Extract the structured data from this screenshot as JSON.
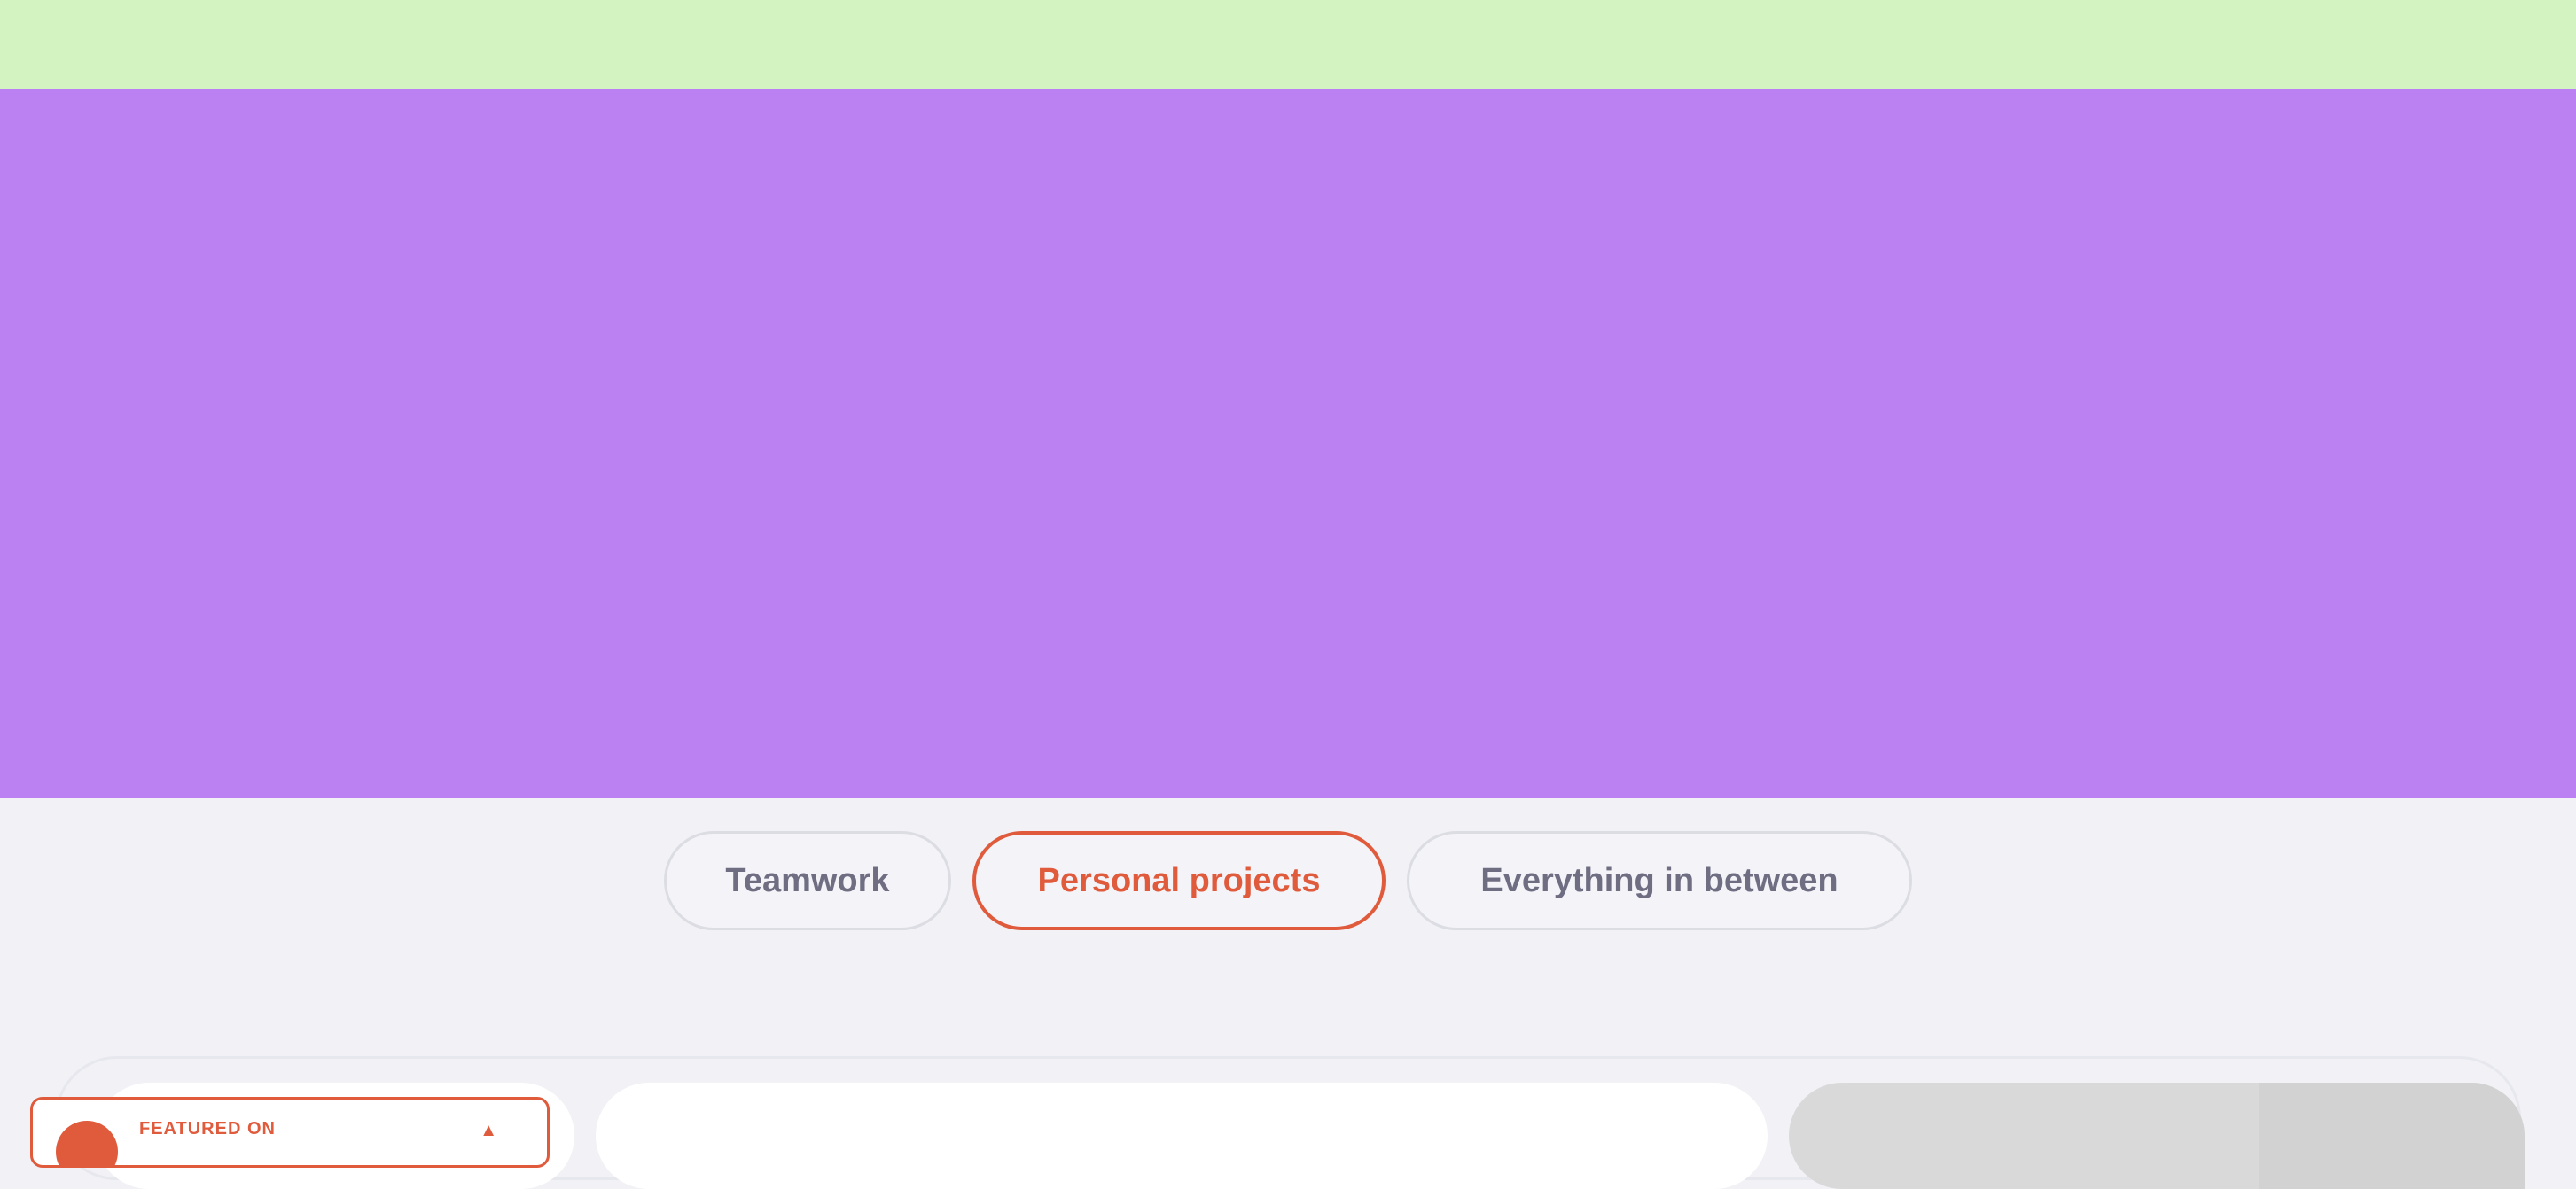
{
  "colors": {
    "top_strip": "#d3f3c0",
    "hero": "#bb80f2",
    "page_background": "#f1f1f6",
    "accent": "#e05a3c",
    "tab_text": "#6f6d82",
    "tab_border": "#dcdce3"
  },
  "tabs": [
    {
      "label": "Teamwork",
      "active": false
    },
    {
      "label": "Personal projects",
      "active": true
    },
    {
      "label": "Everything in between",
      "active": false
    }
  ],
  "featured_badge": {
    "label": "FEATURED ON",
    "logo_icon": "product-hunt-logo-icon",
    "arrow_icon": "upvote-arrow-icon"
  }
}
